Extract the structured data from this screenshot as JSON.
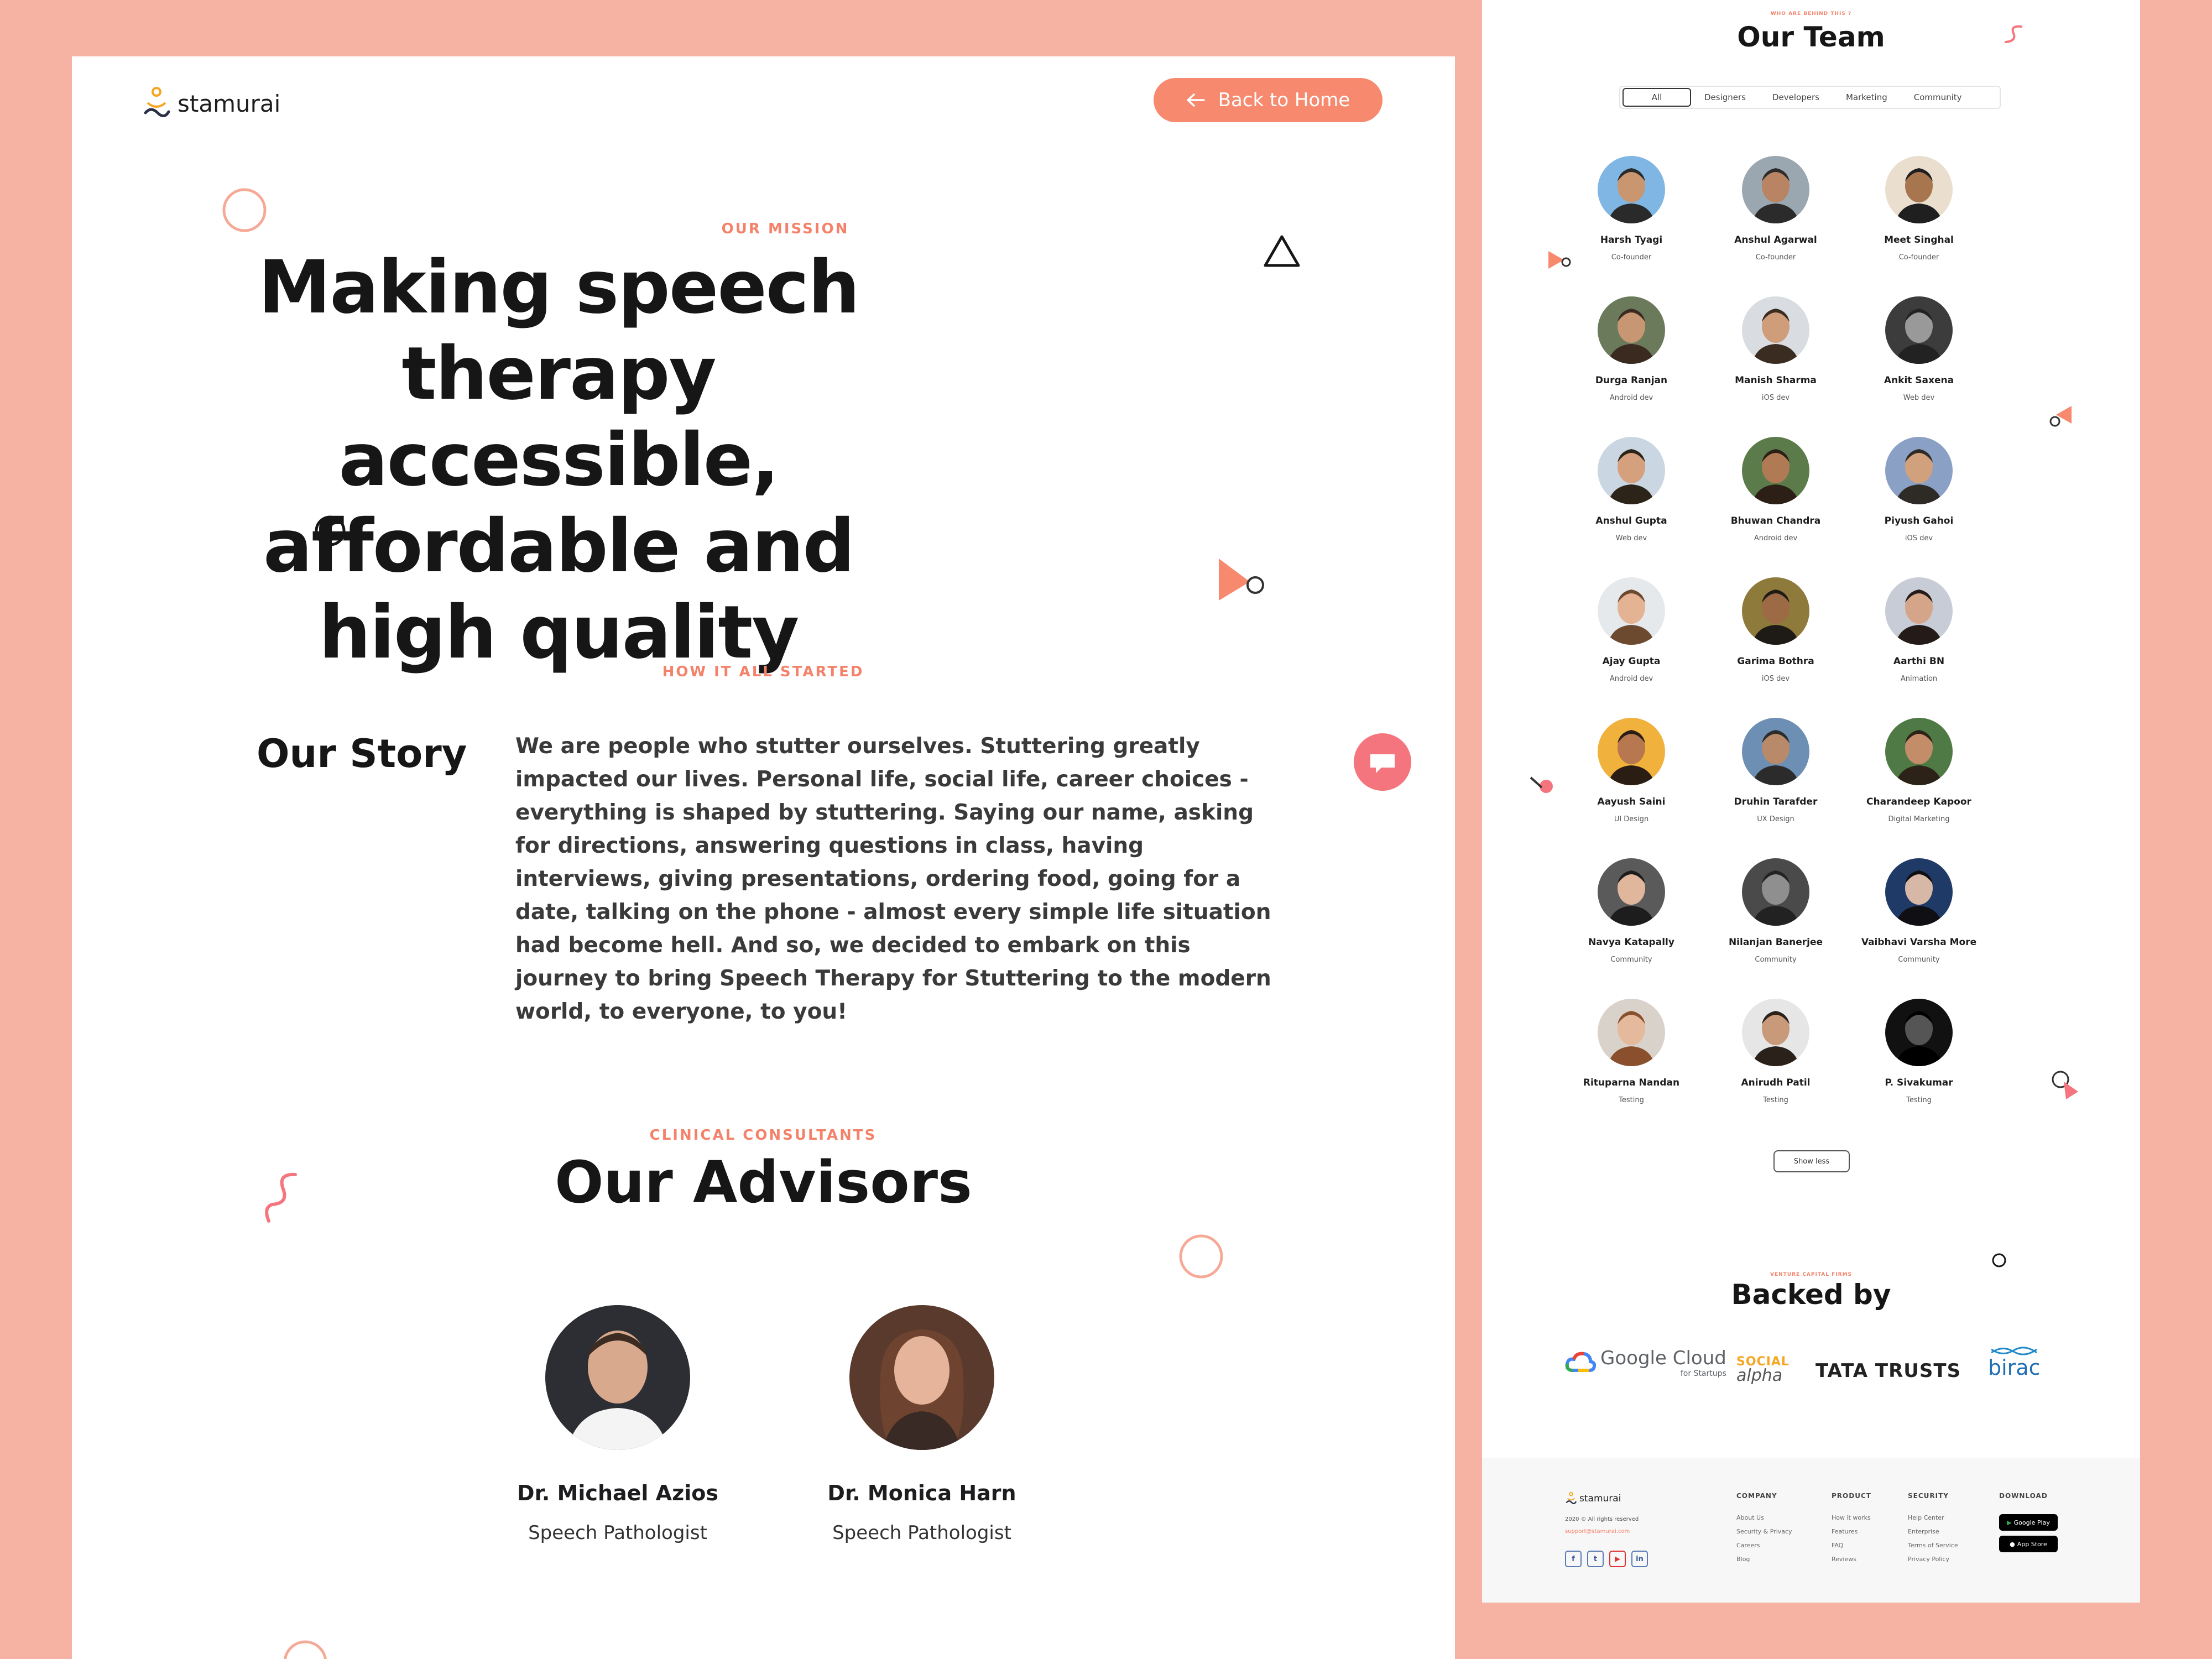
{
  "brand": {
    "name": "stamurai",
    "accent": "#f6896e",
    "background": "#f6b3a3"
  },
  "header": {
    "back_label": "Back to Home"
  },
  "mission": {
    "eyebrow": "OUR MISSION",
    "title": "Making speech therapy accessible, affordable and high quality"
  },
  "story": {
    "eyebrow": "HOW IT ALL STARTED",
    "title": "Our Story",
    "text": "We are people who stutter ourselves. Stuttering greatly impacted our lives. Personal life, social life, career choices - everything is shaped by stuttering. Saying our name, asking for directions, answering questions in class, having interviews, giving presentations, ordering food, going for a date, talking on the phone - almost every simple life situation had become hell. And so, we decided to embark on this journey to bring Speech Therapy for Stuttering to the modern world, to everyone, to you!"
  },
  "advisors": {
    "eyebrow": "CLINICAL CONSULTANTS",
    "title": "Our Advisors",
    "people": [
      {
        "name": "Dr. Michael Azios",
        "role": "Speech Pathologist"
      },
      {
        "name": "Dr. Monica Harn",
        "role": "Speech Pathologist"
      }
    ]
  },
  "team": {
    "eyebrow": "WHO ARE BEHIND THIS ?",
    "title": "Our Team",
    "filters": [
      "All",
      "Designers",
      "Developers",
      "Marketing",
      "Community"
    ],
    "members": [
      {
        "name": "Harsh Tyagi",
        "role": "Co-founder"
      },
      {
        "name": "Anshul Agarwal",
        "role": "Co-founder"
      },
      {
        "name": "Meet Singhal",
        "role": "Co-founder"
      },
      {
        "name": "Durga Ranjan",
        "role": "Android dev"
      },
      {
        "name": "Manish Sharma",
        "role": "iOS dev"
      },
      {
        "name": "Ankit Saxena",
        "role": "Web dev"
      },
      {
        "name": "Anshul Gupta",
        "role": "Web dev"
      },
      {
        "name": "Bhuwan Chandra",
        "role": "Android dev"
      },
      {
        "name": "Piyush Gahoi",
        "role": "iOS dev"
      },
      {
        "name": "Ajay Gupta",
        "role": "Android dev"
      },
      {
        "name": "Garima Bothra",
        "role": "iOS dev"
      },
      {
        "name": "Aarthi BN",
        "role": "Animation"
      },
      {
        "name": "Aayush Saini",
        "role": "UI Design"
      },
      {
        "name": "Druhin Tarafder",
        "role": "UX Design"
      },
      {
        "name": "Charandeep Kapoor",
        "role": "Digital Marketing"
      },
      {
        "name": "Navya Katapally",
        "role": "Community"
      },
      {
        "name": "Nilanjan Banerjee",
        "role": "Community"
      },
      {
        "name": "Vaibhavi Varsha More",
        "role": "Community"
      },
      {
        "name": "Rituparna Nandan",
        "role": "Testing"
      },
      {
        "name": "Anirudh Patil",
        "role": "Testing"
      },
      {
        "name": "P. Sivakumar",
        "role": "Testing"
      }
    ],
    "show_less": "Show less"
  },
  "backed": {
    "eyebrow": "VENTURE CAPITAL FIRMS",
    "title": "Backed by",
    "sponsors": {
      "google": "Google Cloud",
      "google_sub": "for Startups",
      "social_top": "SOCIAL",
      "social_bottom": "alpha",
      "tata": "TATA TRUSTS",
      "birac": "birac"
    }
  },
  "footer": {
    "brand": "stamurai",
    "copyright": "2020 © All rights reserved",
    "email": "support@stamurai.com",
    "social": [
      "f",
      "t",
      "▶",
      "in"
    ],
    "columns": [
      {
        "title": "COMPANY",
        "links": [
          "About Us",
          "Security & Privacy",
          "Careers",
          "Blog"
        ]
      },
      {
        "title": "PRODUCT",
        "links": [
          "How it works",
          "Features",
          "FAQ",
          "Reviews"
        ]
      },
      {
        "title": "SECURITY",
        "links": [
          "Help Center",
          "Enterprise",
          "Terms of Service",
          "Privacy Policy"
        ]
      }
    ],
    "download": {
      "title": "DOWNLOAD",
      "google_play": "Google Play",
      "app_store": "App Store"
    }
  }
}
